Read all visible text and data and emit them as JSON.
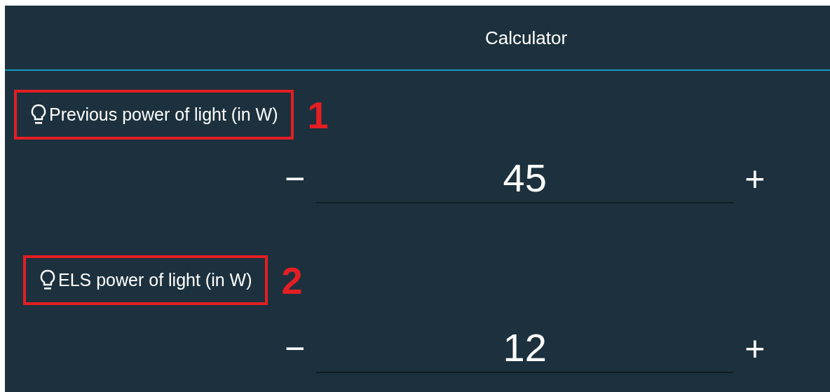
{
  "header": {
    "title": "Calculator"
  },
  "fields": [
    {
      "label": "Previous power of light (in W)",
      "annotation": "1",
      "minus": "−",
      "value": "45",
      "plus": "+"
    },
    {
      "label": "ELS power of light (in W)",
      "annotation": "2",
      "minus": "−",
      "value": "12",
      "plus": "+"
    }
  ]
}
